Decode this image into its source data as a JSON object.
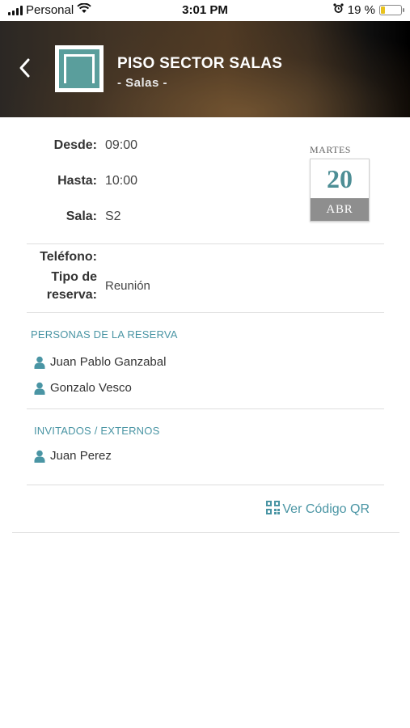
{
  "status_bar": {
    "carrier": "Personal",
    "time": "3:01 PM",
    "battery_percent": "19 %",
    "battery_level": 0.19
  },
  "header": {
    "title": "PISO SECTOR SALAS",
    "subtitle": "- Salas -"
  },
  "reservation": {
    "desde_label": "Desde:",
    "desde_value": "09:00",
    "hasta_label": "Hasta:",
    "hasta_value": "10:00",
    "sala_label": "Sala:",
    "sala_value": "S2",
    "telefono_label": "Teléfono:",
    "telefono_value": "",
    "tipo_label_line1": "Tipo de",
    "tipo_label_line2": "reserva:",
    "tipo_value": "Reunión"
  },
  "date_card": {
    "day_name": "MARTES",
    "day_number": "20",
    "month": "ABR"
  },
  "people_section": {
    "title": "PERSONAS DE LA RESERVA",
    "people": [
      "Juan Pablo Ganzabal",
      "Gonzalo Vesco"
    ]
  },
  "guests_section": {
    "title": "INVITADOS / EXTERNOS",
    "people": [
      "Juan Perez"
    ]
  },
  "qr": {
    "label": "Ver Código QR",
    "icon": "qr-code-icon"
  },
  "colors": {
    "accent": "#4a95a4",
    "date_number": "#4d8e95",
    "month_band": "#8e8e8e",
    "battery": "#e8c21e"
  }
}
